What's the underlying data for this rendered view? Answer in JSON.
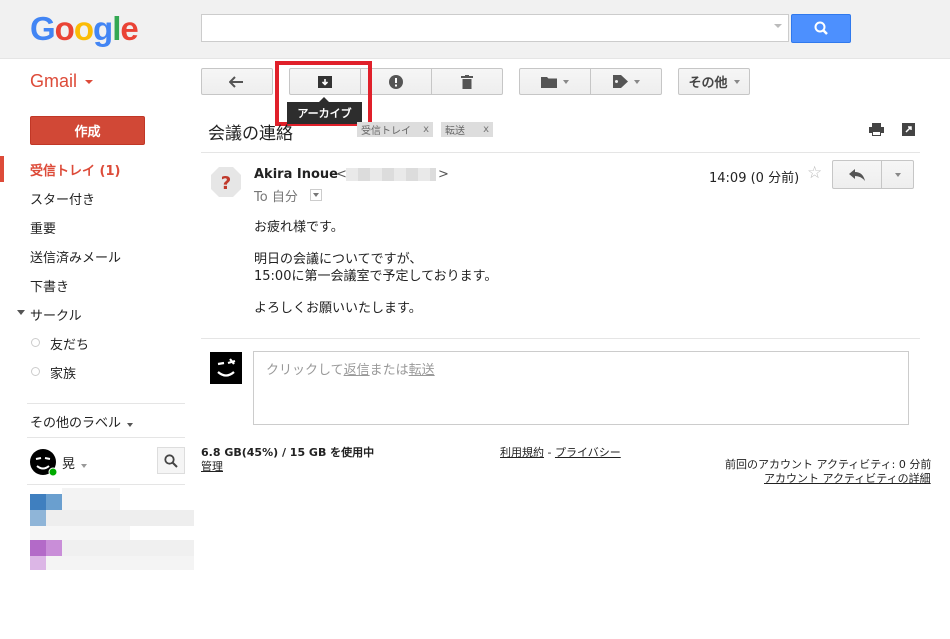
{
  "app": {
    "logo": "Google",
    "product_label": "Gmail"
  },
  "search": {
    "value": "",
    "placeholder": ""
  },
  "toolbar": {
    "back_icon": "arrow-left-icon",
    "archive_icon": "archive-icon",
    "spam_icon": "report-spam-icon",
    "delete_icon": "trash-icon",
    "move_icon": "folder-icon",
    "labels_icon": "tag-icon",
    "more_label": "その他",
    "archive_tooltip": "アーカイブ"
  },
  "sidebar": {
    "compose_label": "作成",
    "items": [
      {
        "label": "受信トレイ (1)",
        "active": true
      },
      {
        "label": "スター付き"
      },
      {
        "label": "重要"
      },
      {
        "label": "送信済みメール"
      },
      {
        "label": "下書き"
      }
    ],
    "circles_label": "サークル",
    "circles": [
      {
        "label": "友だち"
      },
      {
        "label": "家族"
      }
    ],
    "more_labels": "その他のラベル",
    "chat_user": "晃"
  },
  "message": {
    "subject": "会議の連絡",
    "labels": [
      {
        "label": "受信トレイ",
        "remove": "x"
      },
      {
        "label": "転送",
        "remove": "x"
      }
    ],
    "sender_name": "Akira Inoue",
    "sender_open": "<",
    "sender_close": ">",
    "to_line": "To 自分",
    "timestamp": "14:09 (0 分前)",
    "body": [
      "お疲れ様です。",
      "明日の会議についてですが、",
      "15:00に第一会議室で予定しております。",
      "よろしくお願いいたします。"
    ],
    "reply_prompt": {
      "prefix": "クリックして",
      "reply": "返信",
      "middle": "または",
      "forward": "転送"
    }
  },
  "footer": {
    "storage": "6.8 GB(45%) / 15 GB を使用中",
    "manage": "管理",
    "terms": "利用規約",
    "sep": " - ",
    "privacy": "プライバシー",
    "last_activity": "前回のアカウント アクティビティ: 0 分前",
    "activity_details": "アカウント アクティビティの詳細"
  },
  "colors": {
    "accent_red": "#dd4b39",
    "search_blue": "#4d90fe",
    "highlight": "#e0202a"
  }
}
